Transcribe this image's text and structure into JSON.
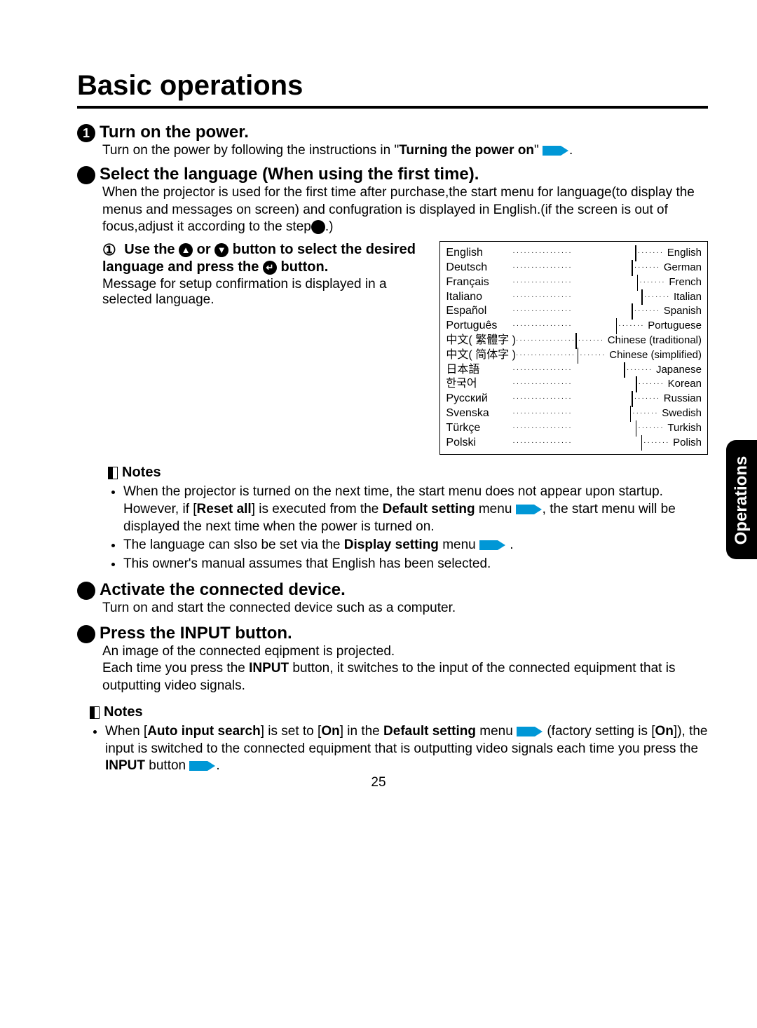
{
  "page": {
    "title": "Basic operations",
    "number": "25",
    "sideTab": "Operations"
  },
  "step1": {
    "num": "1",
    "title": "Turn on the power.",
    "body_a": "Turn on the power by following the instructions in \"",
    "body_b": "Turning the power on",
    "body_c": "\" ",
    "body_d": "."
  },
  "step2": {
    "title": "Select the language (When using the first time).",
    "body": "When the projector is used for the first time after purchase,the start menu for language(to display the menus and messages on screen) and confugration is displayed in English.(if the screen is out of focus,adjust it according to the step",
    "body_end": ".)",
    "sub_marker": "①",
    "sub_a": "Use the ",
    "sub_b": " or ",
    "sub_c": " button to select the desired language and press the ",
    "sub_d": " button.",
    "sub_text": "Message for setup confirmation is displayed in a selected language."
  },
  "languages": [
    {
      "l": "English",
      "r": "English"
    },
    {
      "l": "Deutsch",
      "r": "German"
    },
    {
      "l": "Français",
      "r": "French"
    },
    {
      "l": "Italiano",
      "r": "Italian"
    },
    {
      "l": "Español",
      "r": "Spanish"
    },
    {
      "l": "Português",
      "r": "Portuguese"
    },
    {
      "l": "中文( 繁體字 )",
      "r": "Chinese (traditional)"
    },
    {
      "l": "中文( 简体字 )",
      "r": "Chinese (simplified)"
    },
    {
      "l": "日本語",
      "r": "Japanese"
    },
    {
      "l": "한국어",
      "r": "Korean"
    },
    {
      "l": "Русский",
      "r": "Russian"
    },
    {
      "l": "Svenska",
      "r": "Swedish"
    },
    {
      "l": "Türkçe",
      "r": "Turkish"
    },
    {
      "l": "Polski",
      "r": "Polish"
    }
  ],
  "notes1": {
    "title": "Notes",
    "i1a": "When the projector is turned on the next time, the start menu does not appear upon startup. However, if [",
    "i1b": "Reset all",
    "i1c": "] is executed from the ",
    "i1d": "Default setting",
    "i1e": " menu ",
    "i1f": ", the start menu will be displayed the next time when the power is turned on.",
    "i2a": "The language can slso be set via the ",
    "i2b": "Display setting",
    "i2c": " menu ",
    "i2d": " .",
    "i3": "This owner's manual assumes that English has been selected."
  },
  "step3": {
    "title": "Activate the connected device.",
    "body": "Turn on and start the connected device such as a computer."
  },
  "step4": {
    "title": "Press the INPUT button.",
    "body1": "An image of the connected eqipment is projected.",
    "body2a": "Each time you press the ",
    "body2b": "INPUT",
    "body2c": " button, it switches to the input of the connected equipment that is outputting video signals."
  },
  "notes2": {
    "title": "Notes",
    "i1a": "When [",
    "i1b": "Auto input search",
    "i1c": "] is set to [",
    "i1d": "On",
    "i1e": "] in the ",
    "i1f": "Default setting",
    "i1g": " menu ",
    "i1h": " (factory setting is [",
    "i1i": "On",
    "i1j": "]), the input is switched to the connected equipment that is outputting video signals each time you press the ",
    "i1k": "INPUT",
    "i1l": " button ",
    "i1m": "."
  }
}
